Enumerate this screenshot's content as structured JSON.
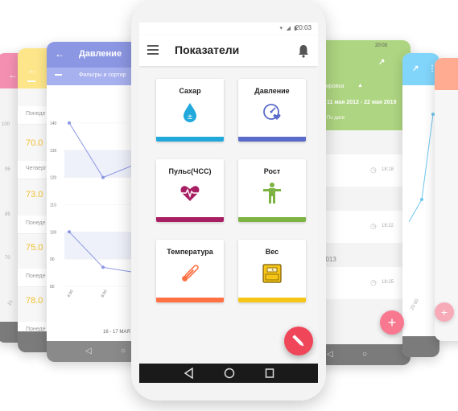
{
  "status": {
    "time": "20:03"
  },
  "main": {
    "title": "Показатели",
    "tiles": [
      {
        "label": "Сахар",
        "icon": "drop-icon",
        "color": "#22a9dc"
      },
      {
        "label": "Давление",
        "icon": "gauge-heart-icon",
        "color": "#5a6bc9"
      },
      {
        "label": "Пульс(ЧСС)",
        "icon": "heart-pulse-icon",
        "color": "#a81e63"
      },
      {
        "label": "Рост",
        "icon": "person-icon",
        "color": "#7cb342"
      },
      {
        "label": "Температура",
        "icon": "thermometer-icon",
        "color": "#ff7043"
      },
      {
        "label": "Вес",
        "icon": "scale-icon",
        "color": "#f5c518"
      }
    ]
  },
  "left_yellow": {
    "rows": [
      {
        "label": "Понеде",
        "value": "70.0"
      },
      {
        "label": "Четверг",
        "value": "73.0"
      },
      {
        "label": "Понеде",
        "value": "75.0"
      },
      {
        "label": "Понеде",
        "value": "78.0"
      },
      {
        "label": "Понеде",
        "value": ""
      }
    ]
  },
  "far_left": {
    "ticks": [
      "100",
      "95",
      "85",
      "70"
    ],
    "rot_label": "15"
  },
  "pressure": {
    "title": "Давление",
    "subtitle": "Фильтры и сортир",
    "chart_data": {
      "type": "line",
      "series": [
        {
          "values": [
            140,
            120,
            125
          ]
        },
        {
          "values": [
            100,
            87,
            85
          ]
        }
      ],
      "x": [
        "4:00",
        "8:00",
        "1"
      ],
      "ylim": [
        80,
        145
      ],
      "yticks": [
        "140",
        "130",
        "120",
        "110",
        "100",
        "90",
        "80"
      ],
      "xlabel": "16 - 17 МАЯ"
    }
  },
  "right_green": {
    "sort_label": "ртировка",
    "date_range": "11 мая 2012 - 22 мая 2019",
    "by_date": "По дате",
    "times": [
      "18:18",
      "18:22",
      "18:25"
    ],
    "year": "2013"
  },
  "right_blue": {
    "xtick": "20:00"
  }
}
